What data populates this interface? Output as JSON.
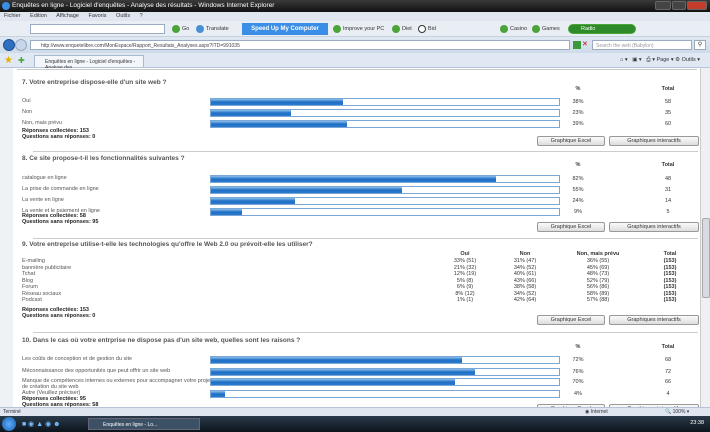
{
  "window": {
    "title": "Enquêtes en ligne - Logiciel d'enquêtes - Analyse des résultats - Windows Internet Explorer"
  },
  "menu": [
    "Fichier",
    "Edition",
    "Affichage",
    "Favoris",
    "Outils",
    "?"
  ],
  "toolbar": {
    "go": "Go",
    "translate": "Translate",
    "speedup": "Speed Up My Computer",
    "improve": "Improve your PC",
    "diet": "Diet",
    "bid": "Bid",
    "casino": "Casino",
    "games": "Games",
    "radio": "Radio"
  },
  "address": {
    "url": "http://www.enquetelibre.com/MonEspace/Rapport_Resultats_Analyses.aspx?ITD=991035",
    "search_placeholder": "Search the web (Babylon)"
  },
  "tab": {
    "label": "Enquêtes en ligne - Logiciel d'enquêtes - Analyse des..."
  },
  "tabtools": {
    "page": "Page",
    "tools": "Outils"
  },
  "headers": {
    "pct": "%",
    "total": "Total",
    "oui": "Oui",
    "non": "Non",
    "nonprevu": "Non, mais prévu"
  },
  "buttons": {
    "excel": "Graphique Excel",
    "interactive": "Graphiques interactifs"
  },
  "q7": {
    "title": "7. Votre entreprise dispose-elle d'un site web ?",
    "rows": [
      {
        "label": "Oui",
        "pct": "38%",
        "value": 38,
        "total": "58"
      },
      {
        "label": "Non",
        "pct": "23%",
        "value": 23,
        "total": "35"
      },
      {
        "label": "Non, mais prévu",
        "pct": "39%",
        "value": 39,
        "total": "60"
      }
    ],
    "collected": "Réponses collectées: 153",
    "unanswered": "Questions sans réponses: 0"
  },
  "q8": {
    "title": "8. Ce site propose-t-il les fonctionnalités suivantes ?",
    "rows": [
      {
        "label": "catalogue en ligne",
        "pct": "82%",
        "value": 82,
        "total": "48"
      },
      {
        "label": "La prise de commande en ligne",
        "pct": "55%",
        "value": 55,
        "total": "31"
      },
      {
        "label": "La vente en ligne",
        "pct": "24%",
        "value": 24,
        "total": "14"
      },
      {
        "label": "La vente et le paiement en ligne",
        "pct": "9%",
        "value": 9,
        "total": "5"
      }
    ],
    "collected": "Réponses collectées: 58",
    "unanswered": "Questions sans réponses: 95"
  },
  "q9": {
    "title": "9. Votre entreprise utilise-t-elle les technologies qu'offre le Web 2.0 ou prévoit-elle les utiliser?",
    "rows": [
      {
        "label": "E-mailing",
        "oui": "33% (51)",
        "non": "31% (47)",
        "prevu": "36% (55)",
        "total": "(153)"
      },
      {
        "label": "bannière publicitaire",
        "oui": "21% (32)",
        "non": "34% (52)",
        "prevu": "45% (69)",
        "total": "(153)"
      },
      {
        "label": "Tchat",
        "oui": "12% (19)",
        "non": "40% (61)",
        "prevu": "48% (73)",
        "total": "(153)"
      },
      {
        "label": "Blog",
        "oui": "5% (8)",
        "non": "43% (66)",
        "prevu": "52% (79)",
        "total": "(153)"
      },
      {
        "label": "Forum",
        "oui": "6% (9)",
        "non": "38% (58)",
        "prevu": "56% (86)",
        "total": "(153)"
      },
      {
        "label": "Réseau sociaux",
        "oui": "8% (12)",
        "non": "34% (52)",
        "prevu": "58% (89)",
        "total": "(153)"
      },
      {
        "label": "Podcast",
        "oui": "1% (1)",
        "non": "42% (64)",
        "prevu": "57% (88)",
        "total": "(153)"
      }
    ],
    "collected": "Réponses collectées: 153",
    "unanswered": "Questions sans réponses: 0"
  },
  "q10": {
    "title": "10. Dans le cas où votre entrprise ne dispose pas d'un site web, quelles sont les raisons ?",
    "rows": [
      {
        "label": "Les coûts de conception et de gestion du site",
        "pct": "72%",
        "value": 72,
        "total": "68"
      },
      {
        "label": "Méconnaissance des opportunités que peut offrir un site web",
        "pct": "76%",
        "value": 76,
        "total": "72"
      },
      {
        "label": "Manque de compétences internes ou externes pour accompagner votre projet de création du site web",
        "pct": "70%",
        "value": 70,
        "total": "66"
      },
      {
        "label": "Autre (Veuillez préciser)",
        "pct": "4%",
        "value": 4,
        "total": "4"
      }
    ],
    "collected": "Réponses collectées: 95",
    "unanswered": "Questions sans réponses: 58"
  },
  "status": {
    "text": "Terminé",
    "zone": "Internet",
    "zoom": "100%"
  },
  "taskbar": {
    "task": "Enquêtes en ligne - Lo...",
    "clock": "23:38"
  }
}
